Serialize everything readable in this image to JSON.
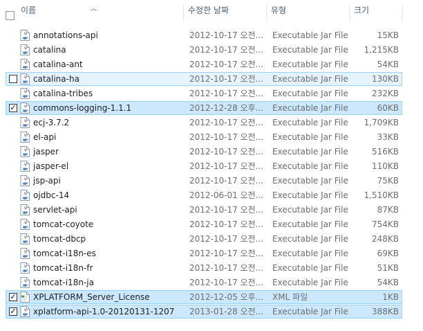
{
  "columns": {
    "name": "이름",
    "date": "수정한 날짜",
    "type": "유형",
    "size": "크기"
  },
  "files": [
    {
      "name": "annotations-api",
      "date": "2012-10-17 오전...",
      "type": "Executable Jar File",
      "size": "15KB",
      "icon": "jar-file-icon",
      "checked": false,
      "state": "normal"
    },
    {
      "name": "catalina",
      "date": "2012-10-17 오전...",
      "type": "Executable Jar File",
      "size": "1,215KB",
      "icon": "jar-file-icon",
      "checked": false,
      "state": "normal"
    },
    {
      "name": "catalina-ant",
      "date": "2012-10-17 오전...",
      "type": "Executable Jar File",
      "size": "54KB",
      "icon": "jar-file-icon",
      "checked": false,
      "state": "normal"
    },
    {
      "name": "catalina-ha",
      "date": "2012-10-17 오전...",
      "type": "Executable Jar File",
      "size": "130KB",
      "icon": "jar-file-icon",
      "checked": false,
      "state": "hover"
    },
    {
      "name": "catalina-tribes",
      "date": "2012-10-17 오전...",
      "type": "Executable Jar File",
      "size": "232KB",
      "icon": "jar-file-icon",
      "checked": false,
      "state": "normal"
    },
    {
      "name": "commons-logging-1.1.1",
      "date": "2012-12-28 오후...",
      "type": "Executable Jar File",
      "size": "60KB",
      "icon": "jar-file-icon",
      "checked": true,
      "state": "selected"
    },
    {
      "name": "ecj-3.7.2",
      "date": "2012-10-17 오전...",
      "type": "Executable Jar File",
      "size": "1,709KB",
      "icon": "jar-file-icon",
      "checked": false,
      "state": "normal"
    },
    {
      "name": "el-api",
      "date": "2012-10-17 오전...",
      "type": "Executable Jar File",
      "size": "33KB",
      "icon": "jar-file-icon",
      "checked": false,
      "state": "normal"
    },
    {
      "name": "jasper",
      "date": "2012-10-17 오전...",
      "type": "Executable Jar File",
      "size": "516KB",
      "icon": "jar-file-icon",
      "checked": false,
      "state": "normal"
    },
    {
      "name": "jasper-el",
      "date": "2012-10-17 오전...",
      "type": "Executable Jar File",
      "size": "110KB",
      "icon": "jar-file-icon",
      "checked": false,
      "state": "normal"
    },
    {
      "name": "jsp-api",
      "date": "2012-10-17 오전...",
      "type": "Executable Jar File",
      "size": "75KB",
      "icon": "jar-file-icon",
      "checked": false,
      "state": "normal"
    },
    {
      "name": "ojdbc-14",
      "date": "2012-06-01 오전...",
      "type": "Executable Jar File",
      "size": "1,510KB",
      "icon": "jar-file-icon",
      "checked": false,
      "state": "normal"
    },
    {
      "name": "servlet-api",
      "date": "2012-10-17 오전...",
      "type": "Executable Jar File",
      "size": "87KB",
      "icon": "jar-file-icon",
      "checked": false,
      "state": "normal"
    },
    {
      "name": "tomcat-coyote",
      "date": "2012-10-17 오전...",
      "type": "Executable Jar File",
      "size": "754KB",
      "icon": "jar-file-icon",
      "checked": false,
      "state": "normal"
    },
    {
      "name": "tomcat-dbcp",
      "date": "2012-10-17 오전...",
      "type": "Executable Jar File",
      "size": "248KB",
      "icon": "jar-file-icon",
      "checked": false,
      "state": "normal"
    },
    {
      "name": "tomcat-i18n-es",
      "date": "2012-10-17 오전...",
      "type": "Executable Jar File",
      "size": "69KB",
      "icon": "jar-file-icon",
      "checked": false,
      "state": "normal"
    },
    {
      "name": "tomcat-i18n-fr",
      "date": "2012-10-17 오전...",
      "type": "Executable Jar File",
      "size": "51KB",
      "icon": "jar-file-icon",
      "checked": false,
      "state": "normal"
    },
    {
      "name": "tomcat-i18n-ja",
      "date": "2012-10-17 오전...",
      "type": "Executable Jar File",
      "size": "54KB",
      "icon": "jar-file-icon",
      "checked": false,
      "state": "normal"
    },
    {
      "name": "XPLATFORM_Server_License",
      "date": "2012-12-05 오후...",
      "type": "XML 파일",
      "size": "1KB",
      "icon": "xml-file-icon",
      "checked": true,
      "state": "selected"
    },
    {
      "name": "xplatform-api-1.0-20120131-1207",
      "date": "2013-01-28 오전...",
      "type": "Executable Jar File",
      "size": "388KB",
      "icon": "jar-file-icon",
      "checked": true,
      "state": "selected"
    }
  ],
  "colors": {
    "selected_bg": "#cce8ff",
    "selected_border": "#99d1ff",
    "hover_bg": "#e5f3ff",
    "header_text": "#4c607a",
    "detail_text": "#6d6d6d"
  }
}
